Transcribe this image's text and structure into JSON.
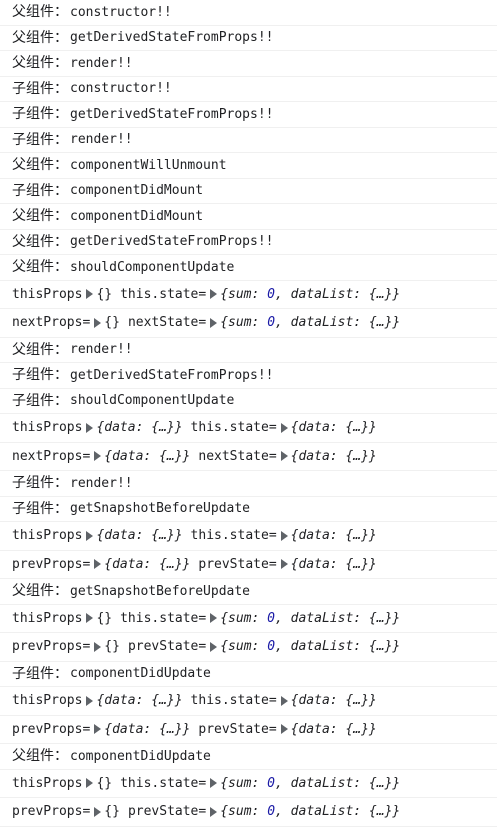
{
  "console": {
    "logs": [
      {
        "type": "plain",
        "prefix": "父组件：",
        "text": "constructor!!"
      },
      {
        "type": "plain",
        "prefix": "父组件：",
        "text": "getDerivedStateFromProps!!"
      },
      {
        "type": "plain",
        "prefix": "父组件：",
        "text": "render!!"
      },
      {
        "type": "plain",
        "prefix": "子组件：",
        "text": "constructor!!"
      },
      {
        "type": "plain",
        "prefix": "子组件：",
        "text": "getDerivedStateFromProps!!"
      },
      {
        "type": "plain",
        "prefix": "子组件：",
        "text": "render!!"
      },
      {
        "type": "plain",
        "prefix": "父组件：",
        "text": "componentWillUnmount"
      },
      {
        "type": "plain",
        "prefix": "子组件：",
        "text": "componentDidMount"
      },
      {
        "type": "plain",
        "prefix": "父组件：",
        "text": "componentDidMount"
      },
      {
        "type": "plain",
        "prefix": "父组件：",
        "text": "getDerivedStateFromProps!!"
      },
      {
        "type": "plain",
        "prefix": "父组件：",
        "text": "shouldComponentUpdate"
      },
      {
        "type": "obj",
        "left": "thisProps",
        "leftObj": "{}",
        "leftItalic": false,
        "right": "this.state=",
        "rightObj": "{sum: 0, dataList: {…}}",
        "rightItalic": true,
        "num": "0"
      },
      {
        "type": "obj",
        "left": "nextProps=",
        "leftObj": "{}",
        "leftItalic": false,
        "right": "nextState=",
        "rightObj": "{sum: 0, dataList: {…}}",
        "rightItalic": true,
        "num": "0"
      },
      {
        "type": "plain",
        "prefix": "父组件：",
        "text": "render!!"
      },
      {
        "type": "plain",
        "prefix": "子组件：",
        "text": "getDerivedStateFromProps!!"
      },
      {
        "type": "plain",
        "prefix": "子组件：",
        "text": "shouldComponentUpdate"
      },
      {
        "type": "obj",
        "left": "thisProps",
        "leftObj": "{data: {…}}",
        "leftItalic": true,
        "right": "this.state=",
        "rightObj": "{data: {…}}",
        "rightItalic": true
      },
      {
        "type": "obj",
        "left": "nextProps=",
        "leftObj": "{data: {…}}",
        "leftItalic": true,
        "right": "nextState=",
        "rightObj": "{data: {…}}",
        "rightItalic": true
      },
      {
        "type": "plain",
        "prefix": "子组件：",
        "text": "render!!"
      },
      {
        "type": "plain",
        "prefix": "子组件：",
        "text": "getSnapshotBeforeUpdate"
      },
      {
        "type": "obj",
        "left": "thisProps",
        "leftObj": "{data: {…}}",
        "leftItalic": true,
        "right": "this.state=",
        "rightObj": "{data: {…}}",
        "rightItalic": true
      },
      {
        "type": "obj",
        "left": "prevProps=",
        "leftObj": "{data: {…}}",
        "leftItalic": true,
        "right": "prevState=",
        "rightObj": "{data: {…}}",
        "rightItalic": true
      },
      {
        "type": "plain",
        "prefix": "父组件：",
        "text": "getSnapshotBeforeUpdate"
      },
      {
        "type": "obj",
        "left": "thisProps",
        "leftObj": "{}",
        "leftItalic": false,
        "right": "this.state=",
        "rightObj": "{sum: 0, dataList: {…}}",
        "rightItalic": true,
        "num": "0"
      },
      {
        "type": "obj",
        "left": "prevProps=",
        "leftObj": "{}",
        "leftItalic": false,
        "right": "prevState=",
        "rightObj": "{sum: 0, dataList: {…}}",
        "rightItalic": true,
        "num": "0"
      },
      {
        "type": "plain",
        "prefix": "子组件：",
        "text": "componentDidUpdate"
      },
      {
        "type": "obj",
        "left": "thisProps",
        "leftObj": "{data: {…}}",
        "leftItalic": true,
        "right": "this.state=",
        "rightObj": "{data: {…}}",
        "rightItalic": true
      },
      {
        "type": "obj",
        "left": "prevProps=",
        "leftObj": "{data: {…}}",
        "leftItalic": true,
        "right": "prevState=",
        "rightObj": "{data: {…}}",
        "rightItalic": true
      },
      {
        "type": "plain",
        "prefix": "父组件：",
        "text": "componentDidUpdate"
      },
      {
        "type": "obj",
        "left": "thisProps",
        "leftObj": "{}",
        "leftItalic": false,
        "right": "this.state=",
        "rightObj": "{sum: 0, dataList: {…}}",
        "rightItalic": true,
        "num": "0"
      },
      {
        "type": "obj",
        "left": "prevProps=",
        "leftObj": "{}",
        "leftItalic": false,
        "right": "prevState=",
        "rightObj": "{sum: 0, dataList: {…}}",
        "rightItalic": true,
        "num": "0"
      }
    ]
  }
}
